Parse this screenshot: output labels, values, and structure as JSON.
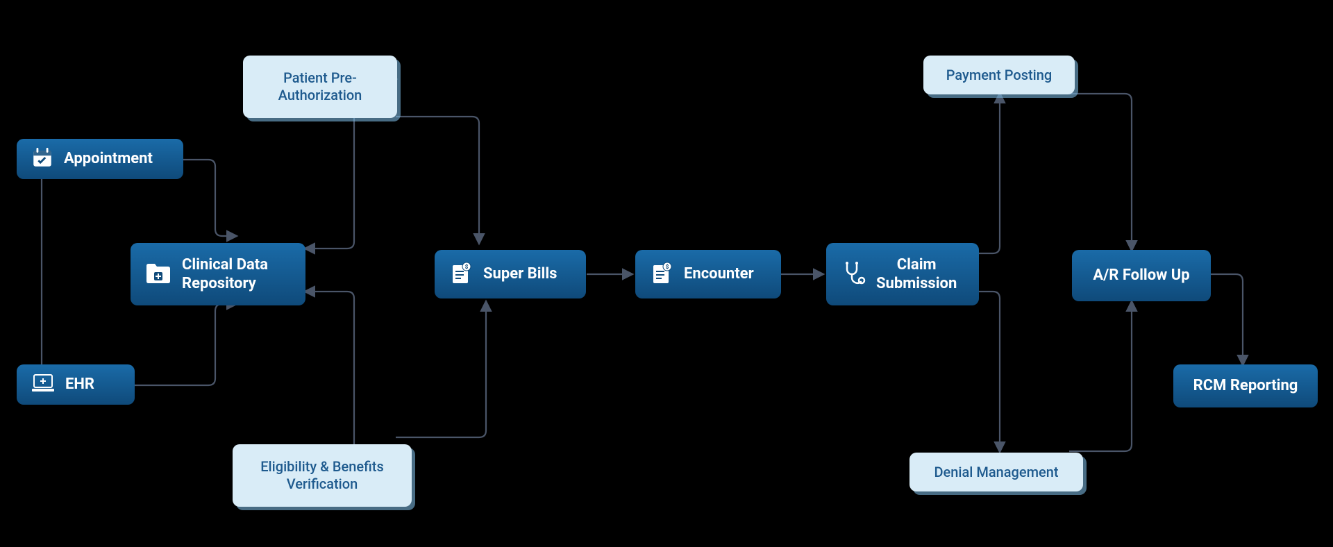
{
  "nodes": {
    "appointment": {
      "label": "Appointment",
      "type": "dark",
      "icon": "calendar"
    },
    "ehr": {
      "label": "EHR",
      "type": "dark",
      "icon": "laptop"
    },
    "cdr": {
      "label": "Clinical Data\nRepository",
      "type": "dark",
      "icon": "folder"
    },
    "preauth": {
      "label": "Patient Pre-\nAuthorization",
      "type": "light"
    },
    "eligibility": {
      "label": "Eligibility & Benefits\nVerification",
      "type": "light"
    },
    "superbills": {
      "label": "Super Bills",
      "type": "dark",
      "icon": "bill"
    },
    "encounter": {
      "label": "Encounter",
      "type": "dark",
      "icon": "bill"
    },
    "claim": {
      "label": "Claim\nSubmission",
      "type": "dark",
      "icon": "stethoscope"
    },
    "payment": {
      "label": "Payment Posting",
      "type": "light"
    },
    "denial": {
      "label": "Denial Management",
      "type": "light"
    },
    "arfollow": {
      "label": "A/R Follow Up",
      "type": "dark"
    },
    "rcm": {
      "label": "RCM Reporting",
      "type": "dark"
    }
  },
  "colors": {
    "dark_bg_top": "#1a6ba8",
    "dark_bg_bottom": "#0f4a7a",
    "light_bg": "#d9ecf7",
    "light_text": "#1e5a8e",
    "connector": "#4a5568"
  }
}
